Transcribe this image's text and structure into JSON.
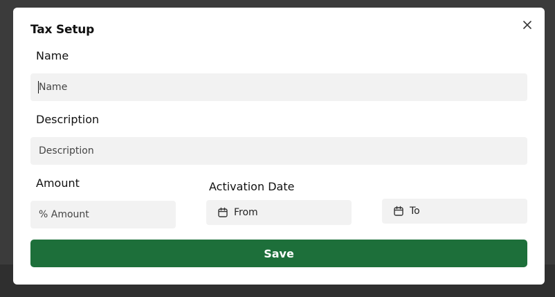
{
  "modal": {
    "title": "Tax Setup",
    "close_icon": "close-icon"
  },
  "form": {
    "name": {
      "label": "Name",
      "placeholder": "Name",
      "value": ""
    },
    "description": {
      "label": "Description",
      "placeholder": "Description",
      "value": ""
    },
    "amount": {
      "label": "Amount",
      "placeholder": "% Amount",
      "value": ""
    },
    "activation_date": {
      "label": "Activation Date",
      "from": {
        "text": "From",
        "icon": "calendar-icon"
      },
      "to": {
        "text": "To",
        "icon": "calendar-icon"
      }
    },
    "save_label": "Save"
  },
  "colors": {
    "primary": "#1d6f3a",
    "field_bg": "#f2f2f2",
    "overlay": "#3b3b3b"
  }
}
